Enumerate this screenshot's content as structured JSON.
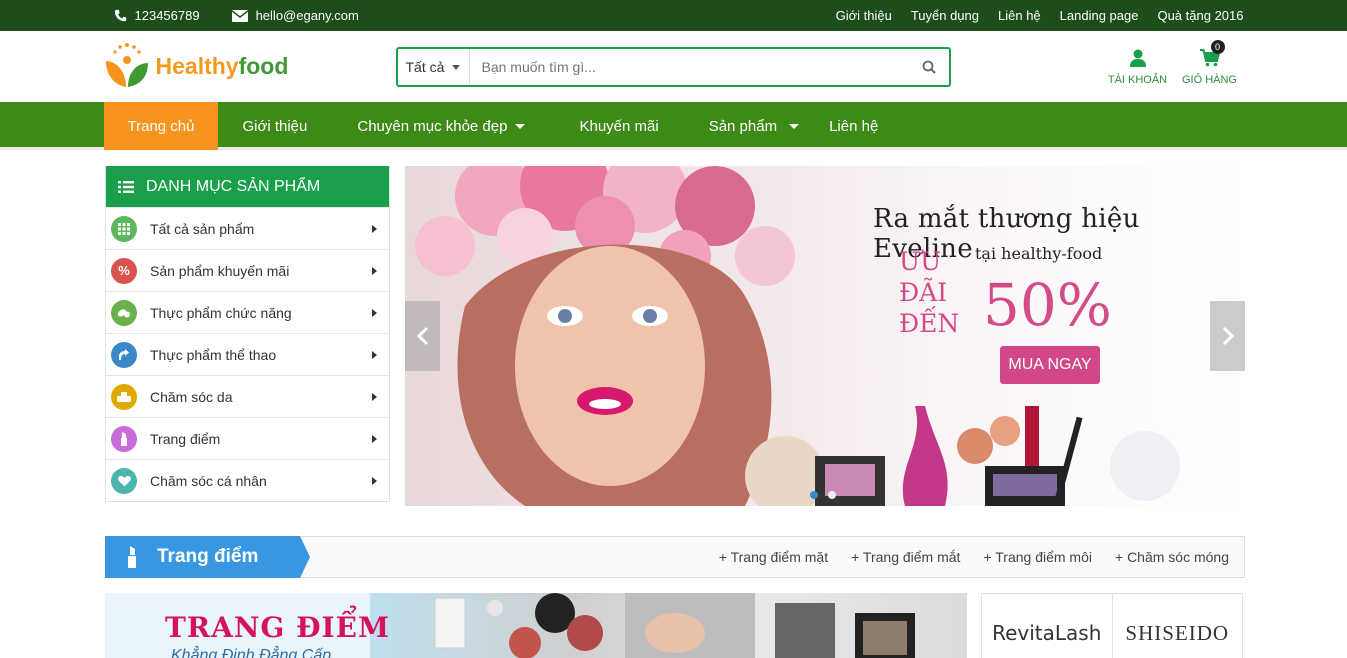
{
  "topbar": {
    "phone": "123456789",
    "email": "hello@egany.com",
    "links": [
      "Giới thiệu",
      "Tuyển dụng",
      "Liên hệ",
      "Landing page",
      "Quà tặng 2016"
    ]
  },
  "header": {
    "logo_part1": "Healthy",
    "logo_part2": "food",
    "search_category": "Tất cả",
    "search_placeholder": "Bạn muốn tìm gì...",
    "account_label": "TÀI KHOẢN",
    "cart_label": "GIỎ HÀNG",
    "cart_count": "0"
  },
  "nav": {
    "items": [
      {
        "label": "Trang chủ",
        "active": true
      },
      {
        "label": "Giới thiệu"
      },
      {
        "label": "Chuyên mục khỏe đẹp",
        "dropdown": true
      },
      {
        "label": "Khuyến mãi"
      },
      {
        "label": "Sản phẩm",
        "dropdown": true
      },
      {
        "label": "Liên hệ"
      }
    ]
  },
  "sidebar": {
    "title": "DANH MỤC SẢN PHẨM",
    "items": [
      {
        "label": "Tất cả sản phẩm",
        "color": "#5cb85c",
        "icon": "grid-icon"
      },
      {
        "label": "Sản phẩm khuyến mãi",
        "color": "#d9534f",
        "icon": "percent-icon"
      },
      {
        "label": "Thực phẩm chức năng",
        "color": "#6ab04c",
        "icon": "pills-icon"
      },
      {
        "label": "Thực phẩm thể thao",
        "color": "#3a87c9",
        "icon": "sport-icon"
      },
      {
        "label": "Chăm sóc da",
        "color": "#e0a800",
        "icon": "skincare-icon"
      },
      {
        "label": "Trang điểm",
        "color": "#c86dd7",
        "icon": "lipstick-icon"
      },
      {
        "label": "Chăm sóc cá nhân",
        "color": "#4db6ac",
        "icon": "heart-icon"
      }
    ]
  },
  "slider": {
    "headline": "Ra mắt thương hiệu Eveline",
    "subline": "tại healthy-food",
    "promo_line1": "ƯU",
    "promo_line2": "ĐÃI",
    "promo_line3": "ĐẾN",
    "percent": "50%",
    "cta": "MUA NGAY"
  },
  "section": {
    "title": "Trang điểm",
    "links": [
      "+ Trang điểm mặt",
      "+ Trang điểm mắt",
      "+ Trang điểm môi",
      "+ Chăm sóc móng"
    ]
  },
  "banner": {
    "title": "TRANG ĐIỂM",
    "subtitle": "Khẳng Định Đẳng Cấp"
  },
  "brands": [
    "RevitaLash",
    "SHISEIDO"
  ]
}
